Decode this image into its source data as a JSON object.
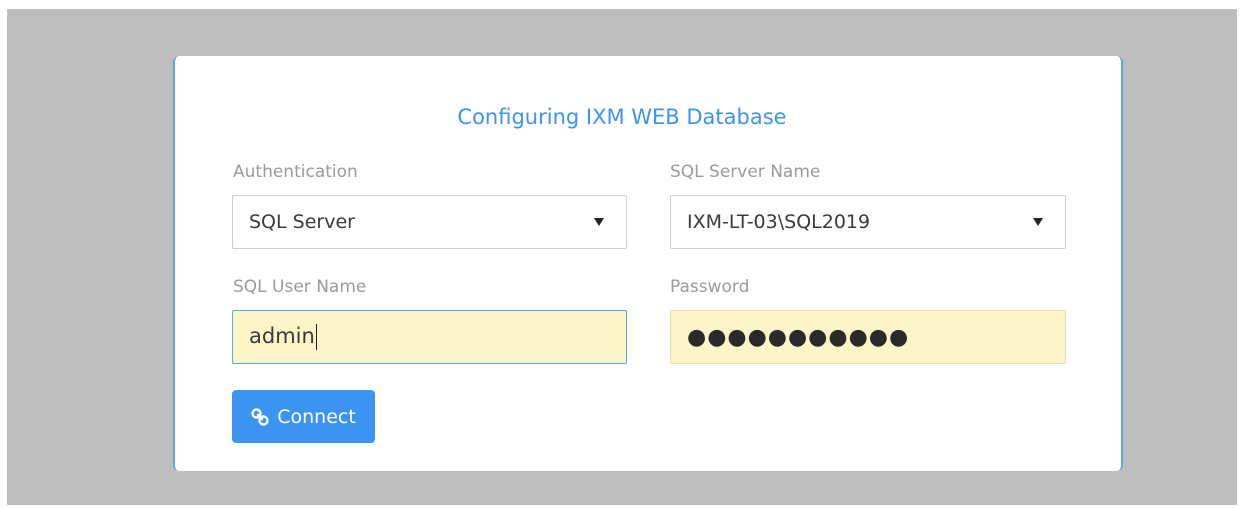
{
  "dialog": {
    "title": "Configuring IXM WEB Database"
  },
  "authentication": {
    "label": "Authentication",
    "value": "SQL Server"
  },
  "server": {
    "label": "SQL Server Name",
    "value": "IXM-LT-03\\SQL2019"
  },
  "username": {
    "label": "SQL User Name",
    "value": "admin"
  },
  "password": {
    "label": "Password",
    "masked_value": "●●●●●●●●●●●"
  },
  "connect_button": {
    "label": "Connect",
    "icon": "link-icon"
  },
  "colors": {
    "accent": "#3c94f2",
    "backdrop": "#bebebe",
    "autofill": "#fdf5c8"
  }
}
